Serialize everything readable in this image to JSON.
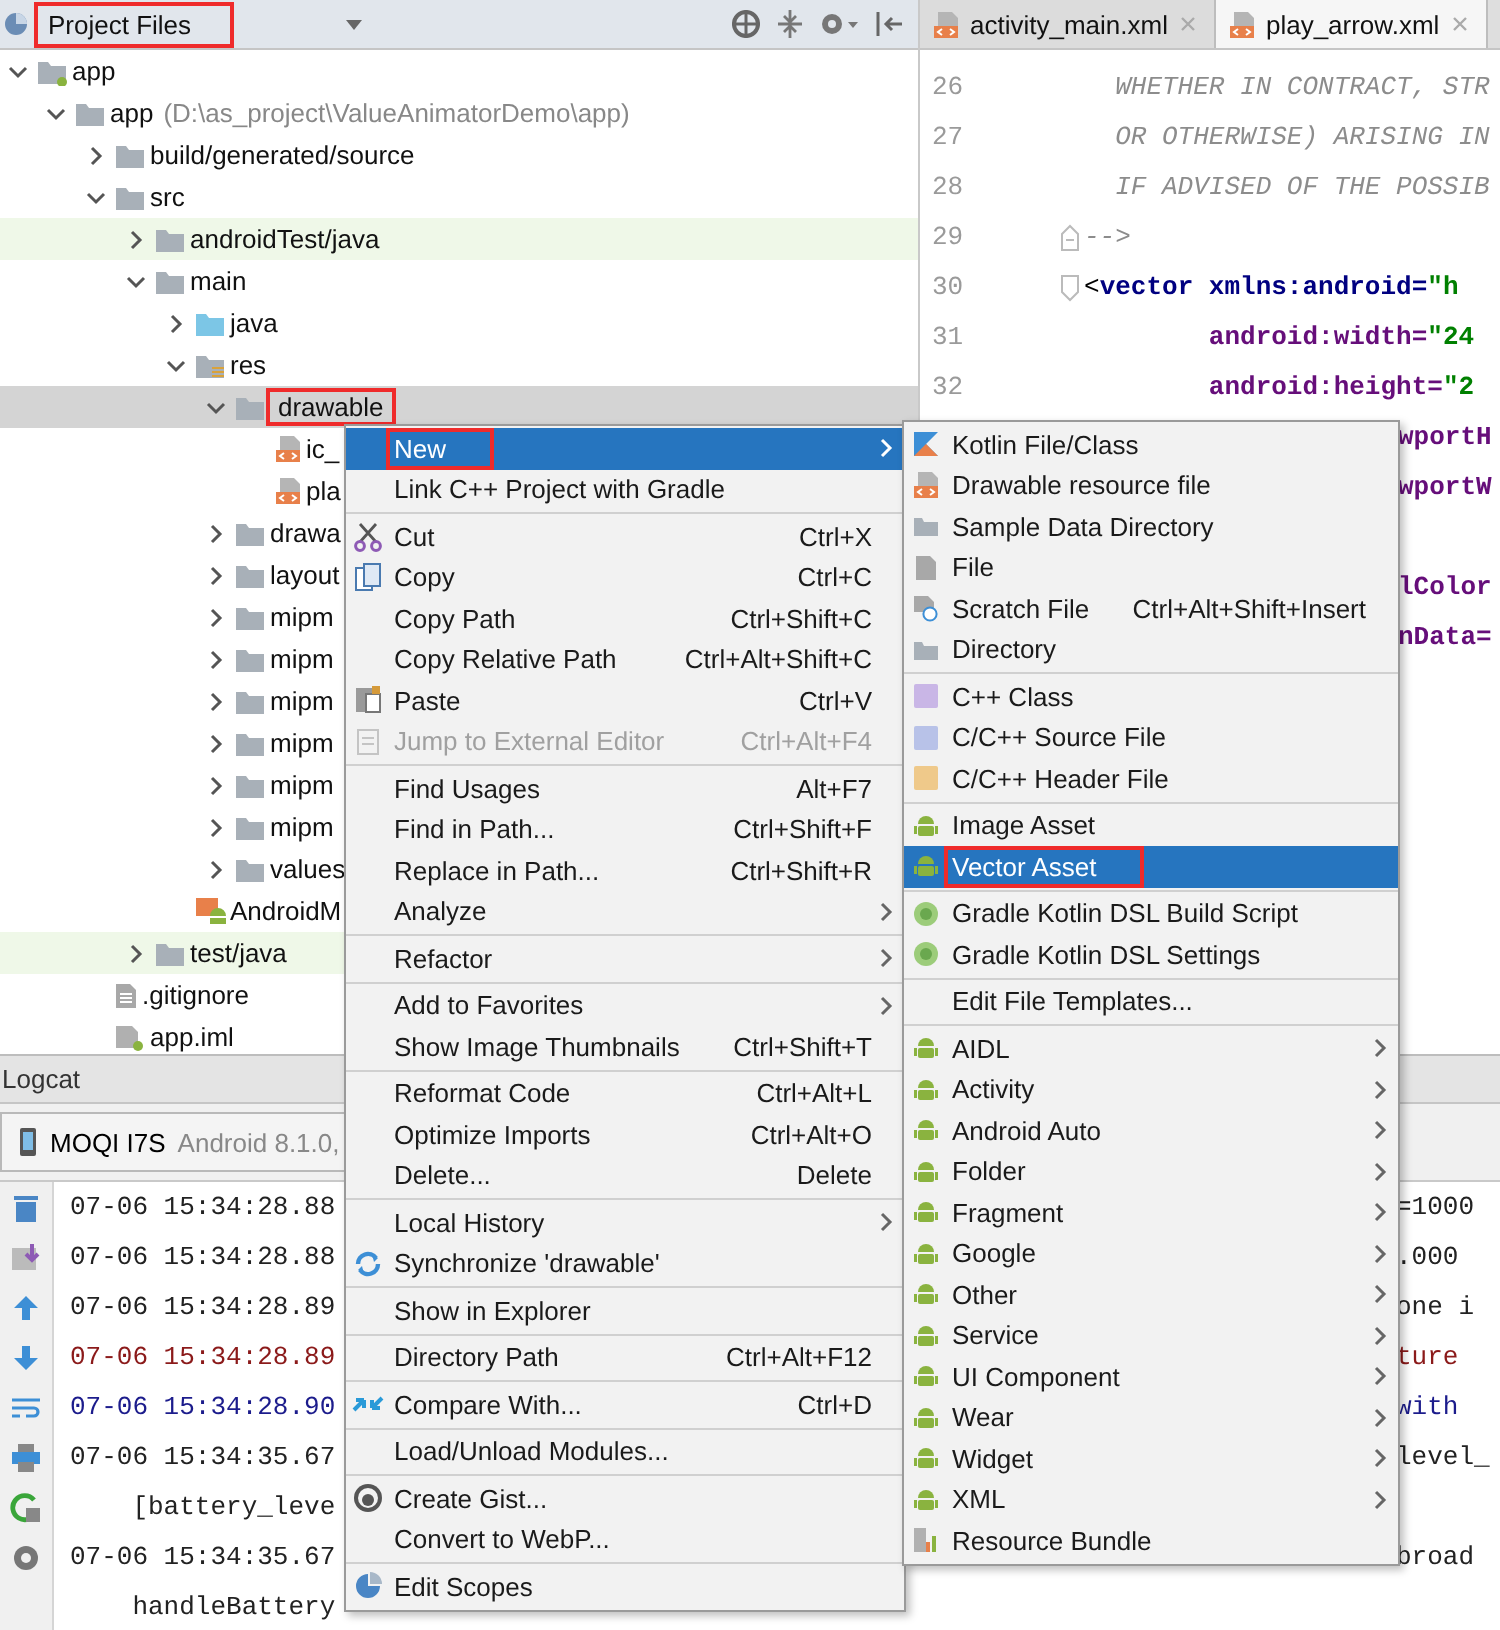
{
  "project_panel": {
    "title": "Project Files",
    "marked": true
  },
  "tree": [
    {
      "label": "app",
      "kind": "module",
      "expanded": true,
      "selected": false,
      "marked": false,
      "children": [
        {
          "label": "app",
          "detail": "(D:\\as_project\\ValueAnimatorDemo\\app)",
          "kind": "folder",
          "expanded": true,
          "selected": false,
          "marked": false,
          "children": [
            {
              "label": "build/generated/source",
              "kind": "folder",
              "expanded": false,
              "selected": false,
              "marked": false
            },
            {
              "label": "src",
              "kind": "folder",
              "expanded": true,
              "selected": false,
              "marked": false,
              "children": [
                {
                  "label": "androidTest/java",
                  "kind": "test-folder",
                  "expanded": false,
                  "selected": false,
                  "marked": false
                },
                {
                  "label": "main",
                  "kind": "folder",
                  "expanded": true,
                  "selected": false,
                  "marked": false,
                  "children": [
                    {
                      "label": "java",
                      "kind": "java-folder",
                      "expanded": false,
                      "selected": false,
                      "marked": false
                    },
                    {
                      "label": "res",
                      "kind": "res-folder",
                      "expanded": true,
                      "selected": false,
                      "marked": false,
                      "children": [
                        {
                          "label": "drawable",
                          "kind": "folder",
                          "expanded": true,
                          "selected": true,
                          "marked": true,
                          "children": [
                            {
                              "label": "ic_",
                              "kind": "vector-file",
                              "selected": false,
                              "marked": false
                            },
                            {
                              "label": "pla",
                              "kind": "vector-file",
                              "selected": false,
                              "marked": false
                            }
                          ]
                        },
                        {
                          "label": "drawa",
                          "kind": "folder",
                          "expanded": false,
                          "selected": false,
                          "marked": false
                        },
                        {
                          "label": "layout",
                          "kind": "folder",
                          "expanded": false,
                          "selected": false,
                          "marked": false
                        },
                        {
                          "label": "mipm",
                          "kind": "folder",
                          "expanded": false,
                          "selected": false,
                          "marked": false
                        },
                        {
                          "label": "mipm",
                          "kind": "folder",
                          "expanded": false,
                          "selected": false,
                          "marked": false
                        },
                        {
                          "label": "mipm",
                          "kind": "folder",
                          "expanded": false,
                          "selected": false,
                          "marked": false
                        },
                        {
                          "label": "mipm",
                          "kind": "folder",
                          "expanded": false,
                          "selected": false,
                          "marked": false
                        },
                        {
                          "label": "mipm",
                          "kind": "folder",
                          "expanded": false,
                          "selected": false,
                          "marked": false
                        },
                        {
                          "label": "mipm",
                          "kind": "folder",
                          "expanded": false,
                          "selected": false,
                          "marked": false
                        },
                        {
                          "label": "values",
                          "kind": "folder",
                          "expanded": false,
                          "selected": false,
                          "marked": false
                        }
                      ]
                    },
                    {
                      "label": "AndroidM",
                      "kind": "manifest",
                      "selected": false,
                      "marked": false
                    }
                  ]
                },
                {
                  "label": "test/java",
                  "kind": "test-folder",
                  "expanded": false,
                  "selected": false,
                  "marked": false
                }
              ]
            },
            {
              "label": ".gitignore",
              "kind": "text-file",
              "selected": false,
              "marked": false
            },
            {
              "label": "app.iml",
              "kind": "iml-file",
              "selected": false,
              "marked": false
            }
          ]
        }
      ]
    }
  ],
  "editor": {
    "tabs": [
      {
        "label": "activity_main.xml",
        "selected": false
      },
      {
        "label": "play_arrow.xml",
        "selected": true
      }
    ],
    "lines": [
      {
        "number": "26",
        "fold_start": false,
        "fold_end": false,
        "segments": [
          {
            "text": "  WHETHER IN CONTRACT, STR",
            "kind": "comment"
          }
        ]
      },
      {
        "number": "27",
        "fold_start": false,
        "fold_end": false,
        "segments": [
          {
            "text": "  OR OTHERWISE) ARISING IN",
            "kind": "comment"
          }
        ]
      },
      {
        "number": "28",
        "fold_start": false,
        "fold_end": false,
        "segments": [
          {
            "text": "  IF ADVISED OF THE POSSIB",
            "kind": "comment"
          }
        ]
      },
      {
        "number": "29",
        "fold_start": false,
        "fold_end": true,
        "segments": [
          {
            "text": "-->",
            "kind": "comment"
          }
        ]
      },
      {
        "number": "30",
        "fold_start": true,
        "fold_end": false,
        "segments": [
          {
            "text": "<",
            "kind": "plain"
          },
          {
            "text": "vector xmlns:android=",
            "kind": "tag"
          },
          {
            "text": "\"h",
            "kind": "string"
          }
        ]
      },
      {
        "number": "31",
        "fold_start": false,
        "fold_end": false,
        "segments": [
          {
            "text": "        android:width=",
            "kind": "attr"
          },
          {
            "text": "\"24",
            "kind": "string"
          }
        ]
      },
      {
        "number": "32",
        "fold_start": false,
        "fold_end": false,
        "segments": [
          {
            "text": "        android:height=",
            "kind": "attr"
          },
          {
            "text": "\"2",
            "kind": "string"
          }
        ]
      }
    ],
    "partly_hidden_lines": [
      {
        "text": "wportH",
        "kind": "attr"
      },
      {
        "text": "wportW",
        "kind": "attr"
      },
      {
        "kind": "blank"
      },
      {
        "text": "lColor",
        "kind": "attr"
      },
      {
        "text": "nData=",
        "kind": "attr"
      }
    ]
  },
  "context_menu": {
    "groups": [
      {
        "items": [
          {
            "label": "New",
            "has_submenu": true,
            "disabled": false,
            "selected": true,
            "marked": true
          },
          {
            "label": "Link C++ Project with Gradle",
            "has_submenu": false,
            "disabled": false,
            "selected": false,
            "marked": false
          }
        ]
      },
      {
        "items": [
          {
            "label": "Cut",
            "shortcut": "Ctrl+X",
            "has_submenu": false,
            "disabled": false,
            "selected": false,
            "marked": false
          },
          {
            "label": "Copy",
            "shortcut": "Ctrl+C",
            "has_submenu": false,
            "disabled": false,
            "selected": false,
            "marked": false
          },
          {
            "label": "Copy Path",
            "shortcut": "Ctrl+Shift+C",
            "has_submenu": false,
            "disabled": false,
            "selected": false,
            "marked": false
          },
          {
            "label": "Copy Relative Path",
            "shortcut": "Ctrl+Alt+Shift+C",
            "has_submenu": false,
            "disabled": false,
            "selected": false,
            "marked": false
          },
          {
            "label": "Paste",
            "shortcut": "Ctrl+V",
            "has_submenu": false,
            "disabled": false,
            "selected": false,
            "marked": false
          },
          {
            "label": "Jump to External Editor",
            "shortcut": "Ctrl+Alt+F4",
            "has_submenu": false,
            "disabled": true,
            "selected": false,
            "marked": false
          }
        ]
      },
      {
        "items": [
          {
            "label": "Find Usages",
            "shortcut": "Alt+F7",
            "has_submenu": false,
            "disabled": false,
            "selected": false,
            "marked": false
          },
          {
            "label": "Find in Path...",
            "shortcut": "Ctrl+Shift+F",
            "has_submenu": false,
            "disabled": false,
            "selected": false,
            "marked": false
          },
          {
            "label": "Replace in Path...",
            "shortcut": "Ctrl+Shift+R",
            "has_submenu": false,
            "disabled": false,
            "selected": false,
            "marked": false
          },
          {
            "label": "Analyze",
            "has_submenu": true,
            "disabled": false,
            "selected": false,
            "marked": false
          }
        ]
      },
      {
        "items": [
          {
            "label": "Refactor",
            "has_submenu": true,
            "disabled": false,
            "selected": false,
            "marked": false
          }
        ]
      },
      {
        "items": [
          {
            "label": "Add to Favorites",
            "has_submenu": true,
            "disabled": false,
            "selected": false,
            "marked": false
          },
          {
            "label": "Show Image Thumbnails",
            "shortcut": "Ctrl+Shift+T",
            "has_submenu": false,
            "disabled": false,
            "selected": false,
            "marked": false
          }
        ]
      },
      {
        "items": [
          {
            "label": "Reformat Code",
            "shortcut": "Ctrl+Alt+L",
            "has_submenu": false,
            "disabled": false,
            "selected": false,
            "marked": false
          },
          {
            "label": "Optimize Imports",
            "shortcut": "Ctrl+Alt+O",
            "has_submenu": false,
            "disabled": false,
            "selected": false,
            "marked": false
          },
          {
            "label": "Delete...",
            "shortcut": "Delete",
            "has_submenu": false,
            "disabled": false,
            "selected": false,
            "marked": false
          }
        ]
      },
      {
        "items": [
          {
            "label": "Local History",
            "has_submenu": true,
            "disabled": false,
            "selected": false,
            "marked": false
          },
          {
            "label": "Synchronize 'drawable'",
            "has_submenu": false,
            "disabled": false,
            "selected": false,
            "marked": false
          }
        ]
      },
      {
        "items": [
          {
            "label": "Show in Explorer",
            "has_submenu": false,
            "disabled": false,
            "selected": false,
            "marked": false
          }
        ]
      },
      {
        "items": [
          {
            "label": "Directory Path",
            "shortcut": "Ctrl+Alt+F12",
            "has_submenu": false,
            "disabled": false,
            "selected": false,
            "marked": false
          }
        ]
      },
      {
        "items": [
          {
            "label": "Compare With...",
            "shortcut": "Ctrl+D",
            "has_submenu": false,
            "disabled": false,
            "selected": false,
            "marked": false
          }
        ]
      },
      {
        "items": [
          {
            "label": "Load/Unload Modules...",
            "has_submenu": false,
            "disabled": false,
            "selected": false,
            "marked": false
          }
        ]
      },
      {
        "items": [
          {
            "label": "Create Gist...",
            "has_submenu": false,
            "disabled": false,
            "selected": false,
            "marked": false
          },
          {
            "label": "Convert to WebP...",
            "has_submenu": false,
            "disabled": false,
            "selected": false,
            "marked": false
          }
        ]
      },
      {
        "items": [
          {
            "label": "Edit Scopes",
            "has_submenu": false,
            "disabled": false,
            "selected": false,
            "marked": false
          }
        ]
      }
    ]
  },
  "submenu": {
    "groups": [
      {
        "items": [
          {
            "label": "Kotlin File/Class",
            "has_submenu": false,
            "selected": false,
            "marked": false
          },
          {
            "label": "Drawable resource file",
            "has_submenu": false,
            "selected": false,
            "marked": false
          },
          {
            "label": "Sample Data Directory",
            "has_submenu": false,
            "selected": false,
            "marked": false
          },
          {
            "label": "File",
            "has_submenu": false,
            "selected": false,
            "marked": false
          },
          {
            "label": "Scratch File",
            "shortcut": "Ctrl+Alt+Shift+Insert",
            "has_submenu": false,
            "selected": false,
            "marked": false
          },
          {
            "label": "Directory",
            "has_submenu": false,
            "selected": false,
            "marked": false
          }
        ]
      },
      {
        "items": [
          {
            "label": "C++ Class",
            "has_submenu": false,
            "selected": false,
            "marked": false
          },
          {
            "label": "C/C++ Source File",
            "has_submenu": false,
            "selected": false,
            "marked": false
          },
          {
            "label": "C/C++ Header File",
            "has_submenu": false,
            "selected": false,
            "marked": false
          }
        ]
      },
      {
        "items": [
          {
            "label": "Image Asset",
            "has_submenu": false,
            "selected": false,
            "marked": false
          },
          {
            "label": "Vector Asset",
            "has_submenu": false,
            "selected": true,
            "marked": true
          }
        ]
      },
      {
        "items": [
          {
            "label": "Gradle Kotlin DSL Build Script",
            "has_submenu": false,
            "selected": false,
            "marked": false
          },
          {
            "label": "Gradle Kotlin DSL Settings",
            "has_submenu": false,
            "selected": false,
            "marked": false
          }
        ]
      },
      {
        "items": [
          {
            "label": "Edit File Templates...",
            "has_submenu": false,
            "selected": false,
            "marked": false
          }
        ]
      },
      {
        "items": [
          {
            "label": "AIDL",
            "has_submenu": true,
            "selected": false,
            "marked": false
          },
          {
            "label": "Activity",
            "has_submenu": true,
            "selected": false,
            "marked": false
          },
          {
            "label": "Android Auto",
            "has_submenu": true,
            "selected": false,
            "marked": false
          },
          {
            "label": "Folder",
            "has_submenu": true,
            "selected": false,
            "marked": false
          },
          {
            "label": "Fragment",
            "has_submenu": true,
            "selected": false,
            "marked": false
          },
          {
            "label": "Google",
            "has_submenu": true,
            "selected": false,
            "marked": false
          },
          {
            "label": "Other",
            "has_submenu": true,
            "selected": false,
            "marked": false
          },
          {
            "label": "Service",
            "has_submenu": true,
            "selected": false,
            "marked": false
          },
          {
            "label": "UI Component",
            "has_submenu": true,
            "selected": false,
            "marked": false
          },
          {
            "label": "Wear",
            "has_submenu": true,
            "selected": false,
            "marked": false
          },
          {
            "label": "Widget",
            "has_submenu": true,
            "selected": false,
            "marked": false
          },
          {
            "label": "XML",
            "has_submenu": true,
            "selected": false,
            "marked": false
          },
          {
            "label": "Resource Bundle",
            "has_submenu": false,
            "selected": false,
            "marked": false
          }
        ]
      }
    ]
  },
  "logcat": {
    "title": "Logcat",
    "device": {
      "name": "MOQI I7S",
      "detail": "Android 8.1.0,"
    },
    "lines": [
      {
        "start": "07-06 15:34:28.88",
        "end": "=1000",
        "color": "#222222"
      },
      {
        "start": "07-06 15:34:28.88",
        "end": ".000",
        "color": "#222222"
      },
      {
        "start": "07-06 15:34:28.89",
        "end": "one i",
        "color": "#222222"
      },
      {
        "start": "07-06 15:34:28.89",
        "end": "ture",
        "color": "#8b1a1a"
      },
      {
        "start": "07-06 15:34:28.90",
        "end": "with",
        "color": "#1c1c8c"
      },
      {
        "start": "07-06 15:34:35.67",
        "end": "level_",
        "color": "#222222"
      },
      {
        "start": "    [battery_leve",
        "color": "#222222"
      },
      {
        "start": "07-06 15:34:35.67",
        "end": "broad",
        "color": "#222222"
      },
      {
        "start": "    handleBattery",
        "color": "#222222"
      }
    ]
  }
}
